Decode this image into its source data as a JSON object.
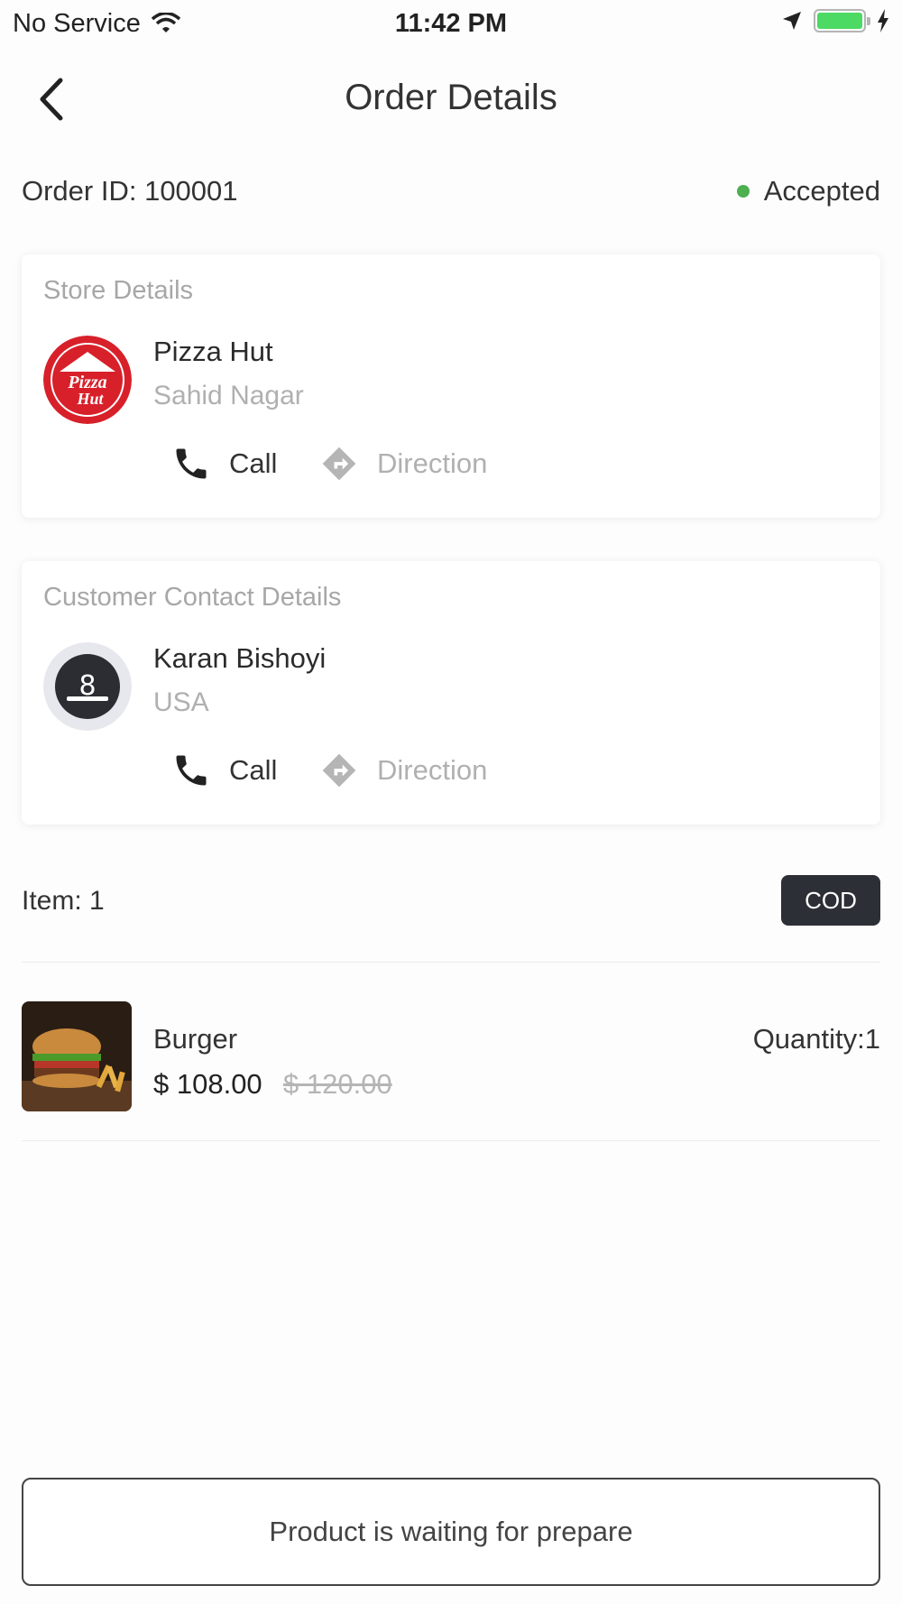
{
  "status_bar": {
    "carrier": "No Service",
    "time": "11:42 PM",
    "icons": [
      "wifi-icon",
      "location-arrow-icon",
      "battery-icon",
      "charging-bolt-icon"
    ],
    "battery_color": "#4cd964"
  },
  "header": {
    "title": "Order Details",
    "back_icon": "chevron-left-icon"
  },
  "order": {
    "id_label": "Order ID: 100001",
    "status": "Accepted",
    "status_color": "#4caf50"
  },
  "store": {
    "section_title": "Store Details",
    "name": "Pizza Hut",
    "location": "Sahid Nagar",
    "logo_icon": "pizza-hut-logo",
    "call_label": "Call",
    "direction_label": "Direction"
  },
  "customer": {
    "section_title": "Customer Contact Details",
    "name": "Karan Bishoyi",
    "location": "USA",
    "avatar_icon": "customer-avatar",
    "call_label": "Call",
    "direction_label": "Direction"
  },
  "items": {
    "count_label": "Item: 1",
    "payment_badge": "COD",
    "list": [
      {
        "name": "Burger",
        "price": "$ 108.00",
        "old_price": "$ 120.00",
        "quantity_label": "Quantity:1",
        "image_icon": "burger-image"
      }
    ]
  },
  "footer": {
    "button_label": "Product is waiting for prepare"
  }
}
